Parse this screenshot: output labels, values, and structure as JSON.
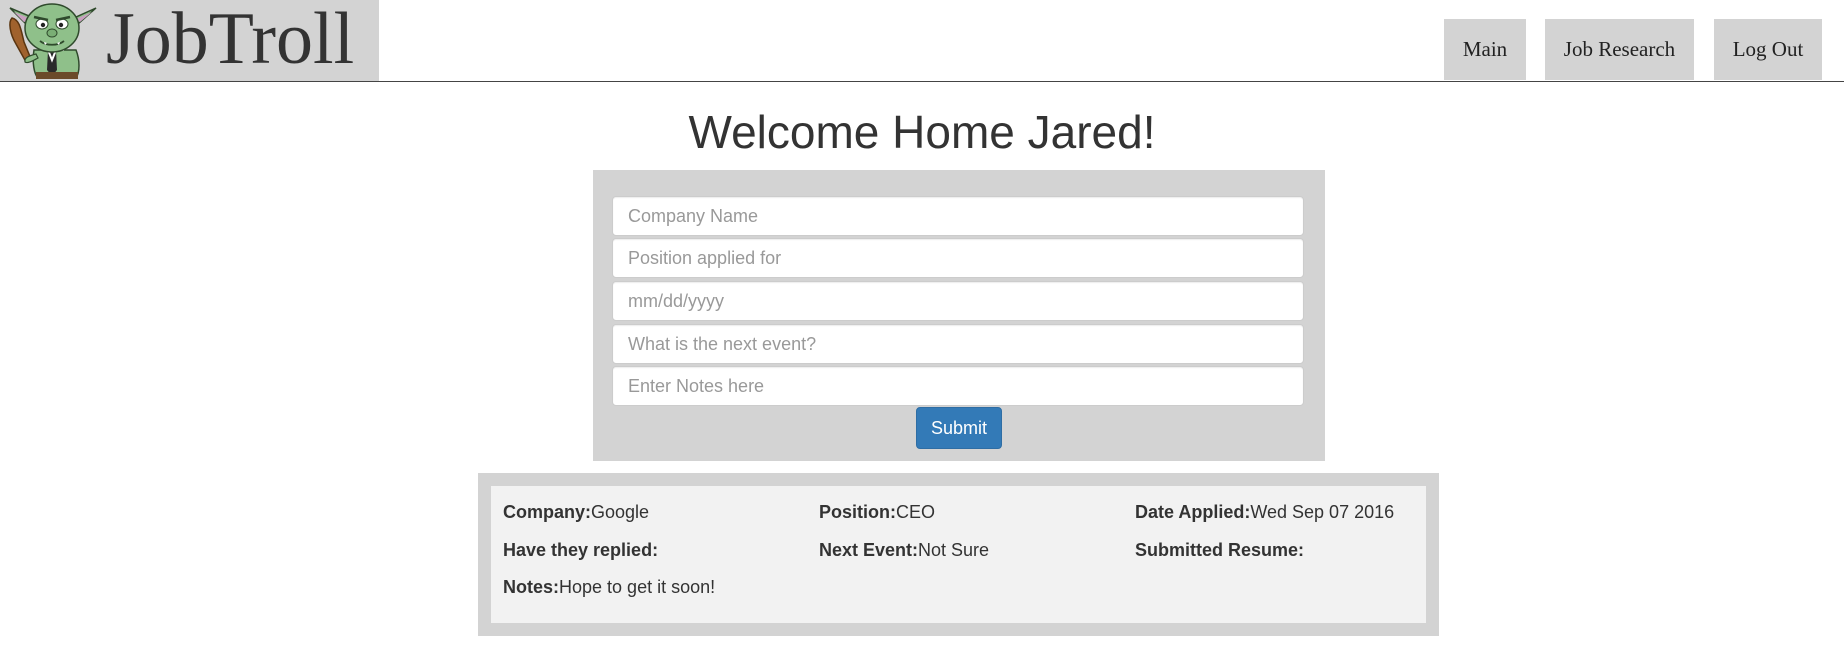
{
  "header": {
    "brand": "JobTroll",
    "logo_icon": "troll-mascot-icon",
    "nav": {
      "main": "Main",
      "job_research": "Job Research",
      "log_out": "Log Out"
    }
  },
  "main": {
    "title": "Welcome Home Jared!",
    "form": {
      "company_placeholder": "Company Name",
      "position_placeholder": "Position applied for",
      "date_placeholder": "mm/dd/yyyy",
      "event_placeholder": "What is the next event?",
      "notes_placeholder": "Enter Notes here",
      "submit_label": "Submit"
    },
    "record": {
      "company_label": "Company:",
      "company_value": "Google",
      "position_label": "Position:",
      "position_value": "CEO",
      "date_label": "Date Applied:",
      "date_value": "Wed Sep 07 2016",
      "replied_label": "Have they replied:",
      "replied_value": "",
      "event_label": "Next Event:",
      "event_value": "Not Sure",
      "resume_label": "Submitted Resume:",
      "resume_value": "",
      "notes_label": "Notes:",
      "notes_value": "Hope to get it soon!"
    }
  },
  "colors": {
    "panel_gray": "#d3d3d3",
    "card_gray": "#f2f2f2",
    "primary_button": "#337ab7",
    "troll_skin": "#8fc08a",
    "club": "#a0622d"
  }
}
